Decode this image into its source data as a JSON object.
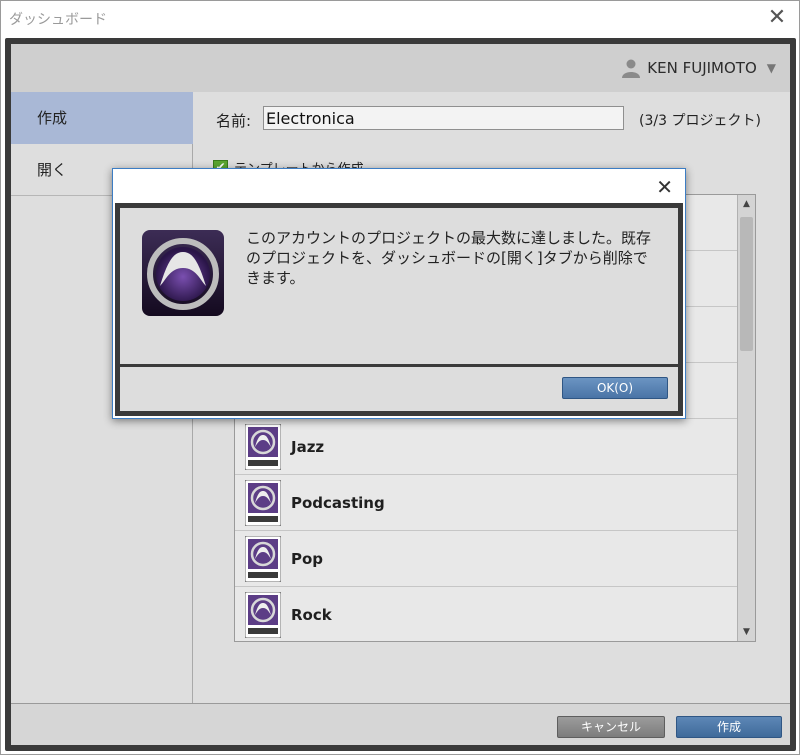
{
  "window": {
    "title": "ダッシュボード"
  },
  "header": {
    "user_name": "KEN FUJIMOTO"
  },
  "sidebar": {
    "items": [
      {
        "label": "作成"
      },
      {
        "label": "開く"
      }
    ]
  },
  "form": {
    "name_label": "名前:",
    "name_value": "Electronica",
    "project_count": "(3/3 プロジェクト)",
    "template_checkbox_label": "テンプレートから作成"
  },
  "template_list": {
    "items": [
      {
        "label": ""
      },
      {
        "label": ""
      },
      {
        "label": ""
      },
      {
        "label": ""
      },
      {
        "label": "Jazz"
      },
      {
        "label": "Podcasting"
      },
      {
        "label": "Pop"
      },
      {
        "label": "Rock"
      }
    ]
  },
  "footer": {
    "cancel_label": "キャンセル",
    "create_label": "作成"
  },
  "modal": {
    "message": "このアカウントのプロジェクトの最大数に達しました。既存のプロジェクトを、ダッシュボードの[開く]タブから削除できます。",
    "ok_label": "OK(O)"
  },
  "icons": {
    "template_icon": "template-icon",
    "app_icon": "pro-tools-app-icon",
    "user_icon": "user-icon"
  },
  "colors": {
    "accent": "#4a74a6",
    "active_nav": "#a9b8d6",
    "frame": "#3a3a3a"
  }
}
